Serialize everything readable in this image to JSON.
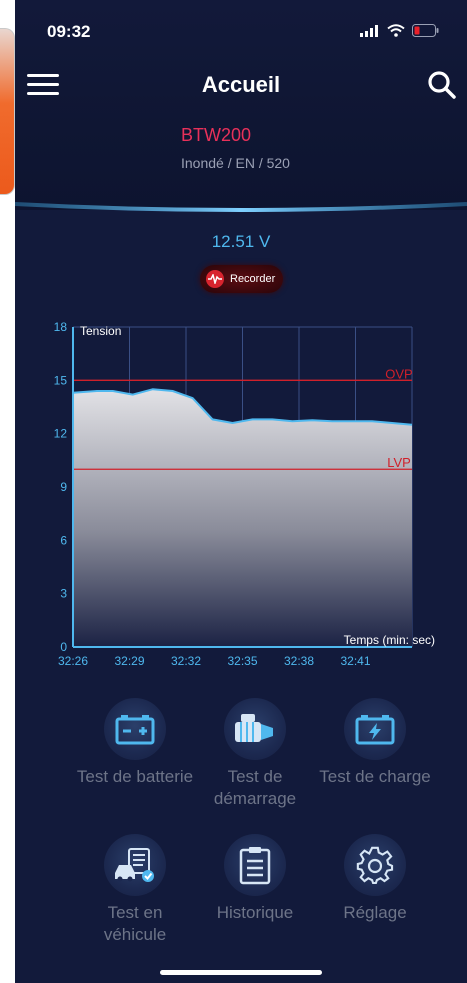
{
  "status": {
    "time": "09:32"
  },
  "header": {
    "title": "Accueil"
  },
  "device": {
    "name": "BTW200",
    "info": "Inondé / EN / 520"
  },
  "reading": {
    "voltage": "12.51 V"
  },
  "recorder": {
    "label": "Recorder"
  },
  "colors": {
    "accent": "#4fb8ee",
    "device": "#e8315a",
    "limit_line": "#d0202a",
    "background": "#121a3b"
  },
  "chart_data": {
    "type": "area",
    "ylabel": "Tension",
    "xlabel": "Temps (min: sec)",
    "ylim": [
      0,
      18
    ],
    "yticks": [
      0,
      3,
      6,
      9,
      12,
      15,
      18
    ],
    "xticks": [
      "32:26",
      "32:29",
      "32:32",
      "32:35",
      "32:38",
      "32:41"
    ],
    "x": [
      0,
      1.2,
      2,
      3,
      4,
      5,
      6,
      7,
      8,
      9,
      10,
      11,
      12,
      13,
      14,
      15,
      16,
      17
    ],
    "values": [
      14.3,
      14.4,
      14.4,
      14.2,
      14.5,
      14.4,
      14.0,
      12.8,
      12.6,
      12.8,
      12.8,
      12.7,
      12.75,
      12.7,
      12.7,
      12.7,
      12.6,
      12.5
    ],
    "x_max": 17,
    "limits": [
      {
        "name": "OVP",
        "value": 15
      },
      {
        "name": "LVP",
        "value": 10
      }
    ],
    "grid": true
  },
  "menu": [
    {
      "label": "Test de batterie",
      "icon": "battery-icon"
    },
    {
      "label": "Test de démarrage",
      "icon": "starter-motor-icon"
    },
    {
      "label": "Test de charge",
      "icon": "charging-battery-icon"
    },
    {
      "label": "Test en véhicule",
      "icon": "car-checklist-icon"
    },
    {
      "label": "Historique",
      "icon": "clipboard-icon"
    },
    {
      "label": "Réglage",
      "icon": "gear-icon"
    }
  ]
}
